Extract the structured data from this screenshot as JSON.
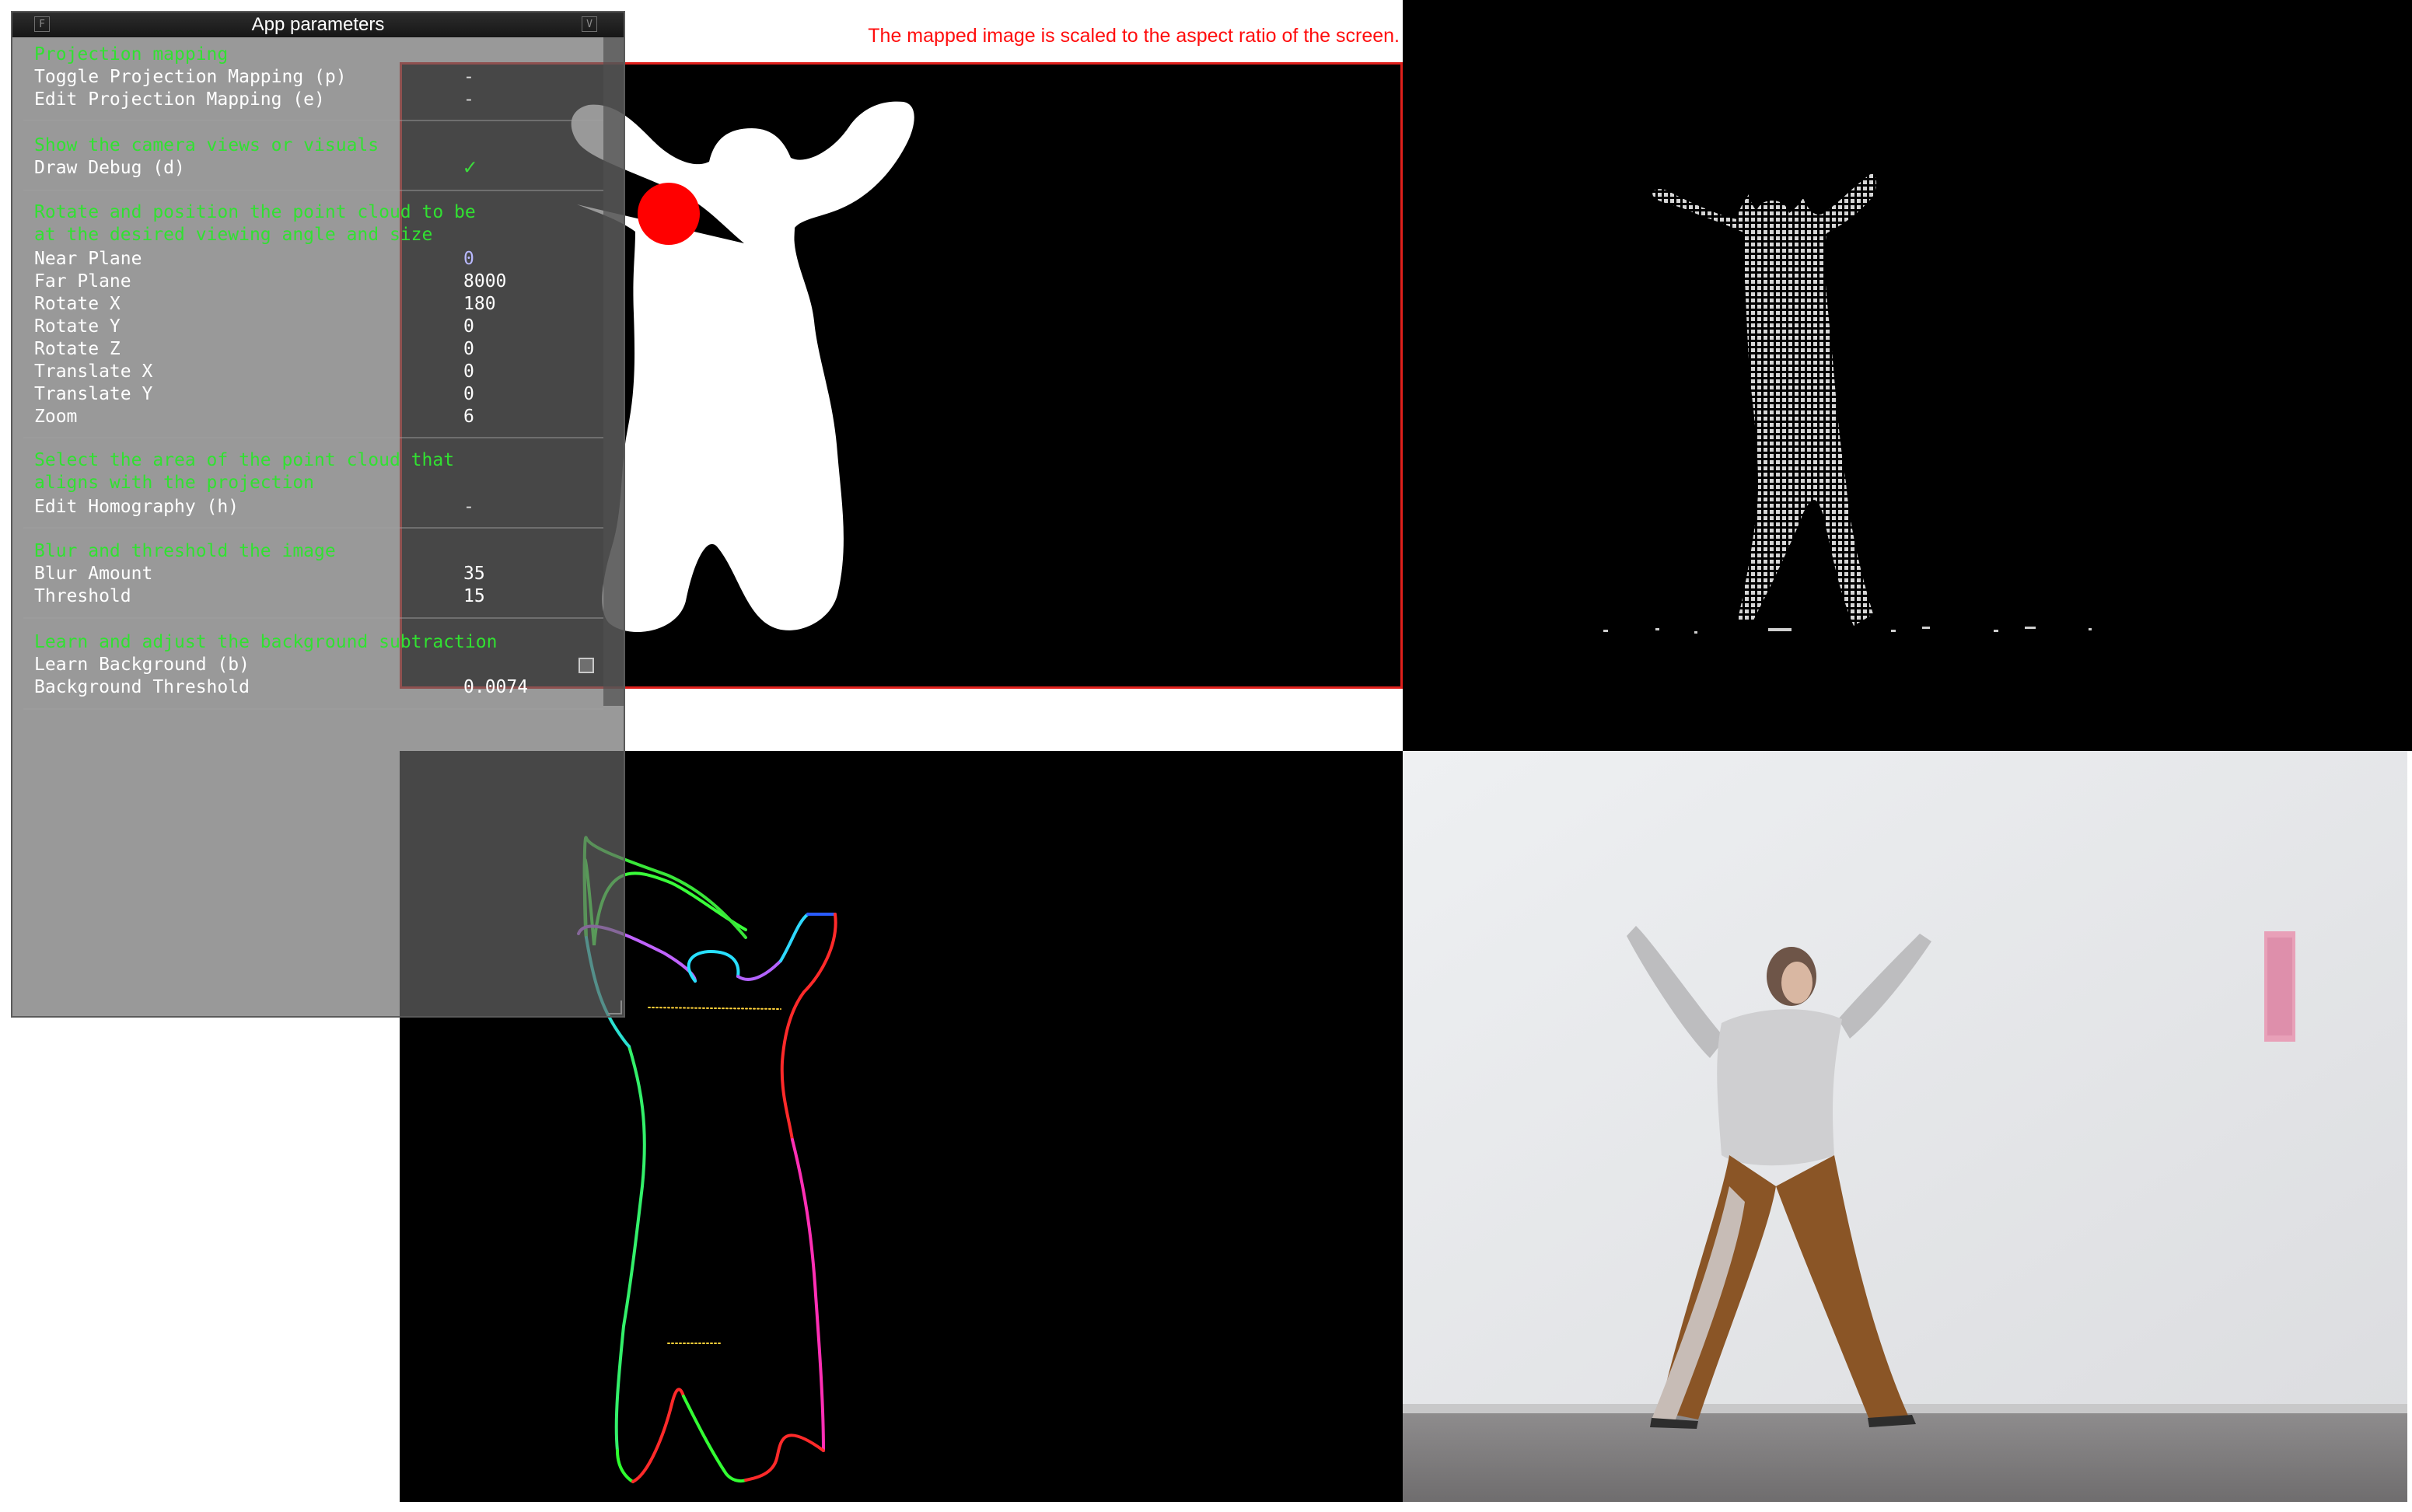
{
  "panel": {
    "title": "App parameters",
    "titlebar_buttons": [
      "F",
      "V"
    ],
    "sections": [
      {
        "heading": "Projection mapping",
        "rows": [
          {
            "label": "Toggle Projection Mapping (p)",
            "value": "-"
          },
          {
            "label": "Edit Projection Mapping (e)",
            "value": "-"
          }
        ]
      },
      {
        "heading": "Show the camera views or visuals",
        "rows": [
          {
            "label": "Draw Debug (d)",
            "value": "✓"
          }
        ]
      },
      {
        "heading": "Rotate and position the point cloud to be\nat the desired viewing angle and size",
        "rows": [
          {
            "label": "Near Plane",
            "value": "0"
          },
          {
            "label": "Far Plane",
            "value": "8000"
          },
          {
            "label": "Rotate X",
            "value": "180"
          },
          {
            "label": "Rotate Y",
            "value": "0"
          },
          {
            "label": "Rotate Z",
            "value": "0"
          },
          {
            "label": "Translate X",
            "value": "0"
          },
          {
            "label": "Translate Y",
            "value": "0"
          },
          {
            "label": "Zoom",
            "value": "6"
          }
        ]
      },
      {
        "heading": "Select the area of the point cloud that\naligns with the projection",
        "rows": [
          {
            "label": "Edit Homography (h)",
            "value": "-"
          }
        ]
      },
      {
        "heading": "Blur and threshold the image",
        "rows": [
          {
            "label": "Blur Amount",
            "value": "35"
          },
          {
            "label": "Threshold",
            "value": "15"
          }
        ]
      },
      {
        "heading": "Learn and adjust the background subtraction",
        "rows": [
          {
            "label": "Learn Background (b)",
            "value": ""
          },
          {
            "label": "Background Threshold",
            "value": "0.0074"
          }
        ]
      }
    ],
    "learn_background_checked": false
  },
  "mapped_note": "The mapped image is scaled to the aspect ratio of the screen.",
  "colors": {
    "panel_heading": "#31e131",
    "mask_border": "#e0201c",
    "note_text": "#ff0d0d",
    "tracking_dot": "#ff0000"
  },
  "views": {
    "mask": "silhouette-mask",
    "point_cloud": "depth-point-cloud",
    "contour": "silhouette-contour",
    "camera": "rgb-camera-feed"
  }
}
